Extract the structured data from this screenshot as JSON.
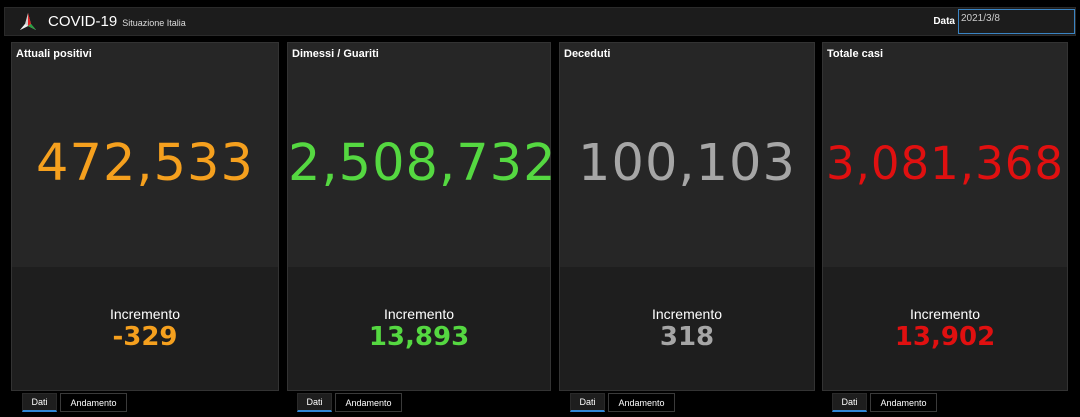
{
  "header": {
    "title": "COVID-19",
    "subtitle": "Situazione Italia",
    "date_label": "Data",
    "date_value": "2021/3/8"
  },
  "cards": [
    {
      "title": "Attuali positivi",
      "value": "472,533",
      "increment_label": "Incremento",
      "increment_value": "-329",
      "color": "#f5a01e"
    },
    {
      "title": "Dimessi / Guariti",
      "value": "2,508,732",
      "increment_label": "Incremento",
      "increment_value": "13,893",
      "color": "#55d841"
    },
    {
      "title": "Deceduti",
      "value": "100,103",
      "increment_label": "Incremento",
      "increment_value": "318",
      "color": "#a6a6a6"
    },
    {
      "title": "Totale casi",
      "value": "3,081,368",
      "increment_label": "Incremento",
      "increment_value": "13,902",
      "color": "#e01010"
    }
  ],
  "tabs": [
    {
      "label": "Dati",
      "active": true
    },
    {
      "label": "Andamento",
      "active": false
    }
  ],
  "colors": {
    "accent": "#2f86d6",
    "background": "#000000",
    "panel": "#262626"
  },
  "icons": {
    "logo": "italy-star-logo-icon"
  }
}
